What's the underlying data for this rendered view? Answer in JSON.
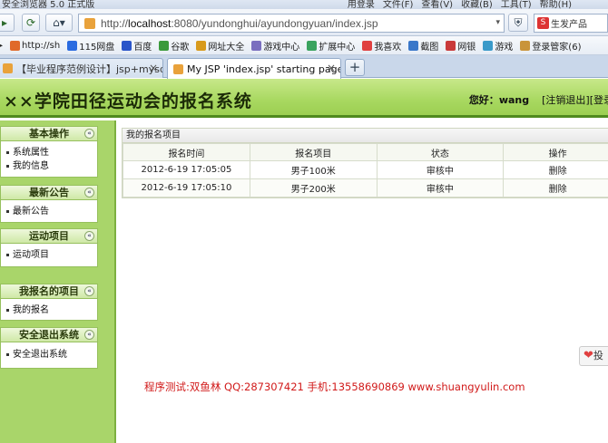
{
  "browser": {
    "window_title": "安全浏览器 5.0 正式版",
    "menu": [
      "用登录",
      "文件(F)",
      "查看(V)",
      "收藏(B)",
      "工具(T)",
      "帮助(H)"
    ],
    "url_host": "localhost",
    "url_rest": ":8080/yundonghui/ayundongyuan/index.jsp",
    "url_prefix": "http://",
    "search_label": "生发产品",
    "bookmarks": [
      {
        "label": "http://sh",
        "color": "#e0692a"
      },
      {
        "label": "115网盘",
        "color": "#2a6be0"
      },
      {
        "label": "百度",
        "color": "#2a55c9"
      },
      {
        "label": "谷歌",
        "color": "#3a9a3a"
      },
      {
        "label": "网址大全",
        "color": "#d89a1c"
      },
      {
        "label": "游戏中心",
        "color": "#7a6fbf"
      },
      {
        "label": "扩展中心",
        "color": "#3aa35f"
      },
      {
        "label": "我喜欢",
        "color": "#e04040"
      },
      {
        "label": "截图",
        "color": "#3a77c9"
      },
      {
        "label": "网银",
        "color": "#c93a3a"
      },
      {
        "label": "游戏",
        "color": "#3a9ac9"
      },
      {
        "label": "登录管家(6)",
        "color": "#c9943a"
      }
    ],
    "tabs": [
      {
        "label": "【毕业程序范例设计】jsp+mysql网...",
        "active": false
      },
      {
        "label": "My JSP 'index.jsp' starting page",
        "active": true
      }
    ],
    "new_tab_label": "+"
  },
  "header": {
    "site_title": "××学院田径运动会的报名系统",
    "hello_label": "您好：",
    "username": "wang",
    "logout_label": "[注销退出]",
    "login_label": "[登录"
  },
  "sidebar": {
    "sections": [
      {
        "title": "基本操作",
        "items": [
          "系统属性",
          "我的信息"
        ]
      },
      {
        "title": "最新公告",
        "items": [
          "最新公告"
        ]
      },
      {
        "title": "运动项目",
        "items": [
          "运动项目"
        ]
      },
      {
        "title": "我报名的项目",
        "items": [
          "我的报名"
        ]
      },
      {
        "title": "安全退出系统",
        "items": [
          "安全退出系统"
        ]
      }
    ],
    "collapse_glyph": "«"
  },
  "main": {
    "panel_title": "我的报名项目",
    "columns": [
      "报名时间",
      "报名项目",
      "状态",
      "操作"
    ],
    "rows": [
      [
        "2012-6-19 17:05:05",
        "男子100米",
        "审核中",
        "删除"
      ],
      [
        "2012-6-19 17:05:10",
        "男子200米",
        "审核中",
        "删除"
      ]
    ]
  },
  "footer": {
    "text": "程序测试:双鱼林 QQ:287307421 手机:13558690869 www.shuangyulin.com"
  },
  "side_widget": {
    "label": "投"
  }
}
